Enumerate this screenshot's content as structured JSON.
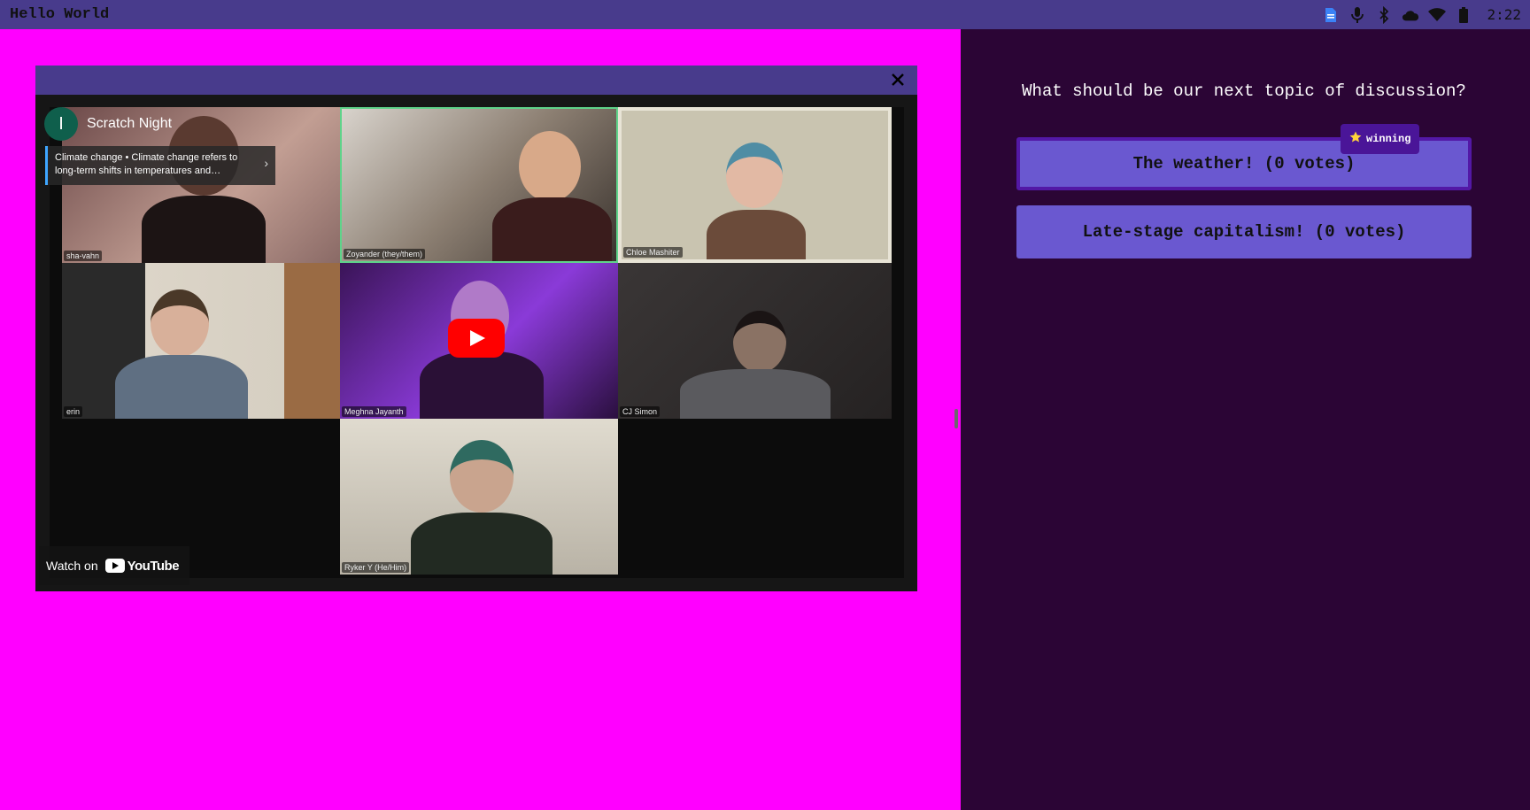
{
  "topbar": {
    "title": "Hello World",
    "clock": "2:22",
    "tray_icons": [
      "docs-icon",
      "microphone-icon",
      "bluetooth-icon",
      "cloud-icon",
      "wifi-icon",
      "battery-icon"
    ],
    "color": "#483b8c"
  },
  "video": {
    "channel_initial": "I",
    "channel_name": "Scratch Night",
    "info_card": "Climate change • Climate change refers to long-term shifts in temperatures and…",
    "watch_on": "Watch on",
    "youtube": "YouTube",
    "participants": [
      "sha-vahn",
      "Zoyander (they/them)",
      "Chloe Mashiter",
      "erin",
      "Meghna Jayanth",
      "CJ Simon",
      "Ryker Y (He/Him)"
    ]
  },
  "poll": {
    "question": "What should be our next topic of discussion?",
    "winning_badge": "winning",
    "options": [
      {
        "label": "The weather! (0 votes)"
      },
      {
        "label": "Late-stage capitalism! (0 votes)"
      }
    ]
  },
  "colors": {
    "left_background": "#ff00ff",
    "right_background": "#2b0535",
    "option_fill": "#6a58d0",
    "badge_fill": "#4a1598"
  }
}
